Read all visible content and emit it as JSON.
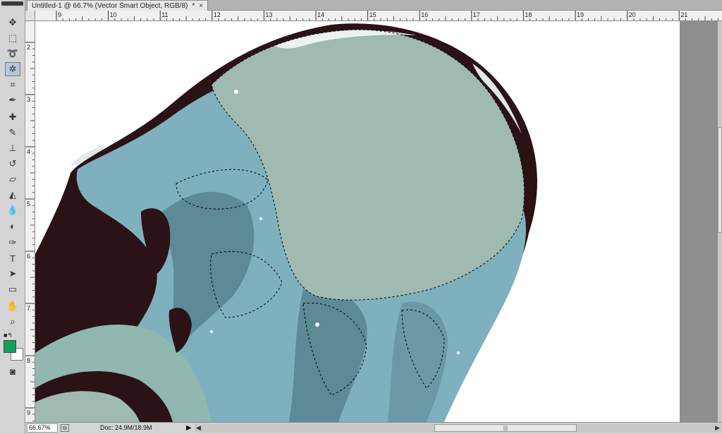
{
  "document": {
    "tab_title": "Untitled-1 @ 66.7% (Vector Smart Object, RGB/8)",
    "modified_marker": "*",
    "close_glyph": "×"
  },
  "rulers": {
    "horizontal": [
      "9",
      "10",
      "11",
      "12",
      "13",
      "14",
      "15",
      "16",
      "17",
      "18",
      "19",
      "20",
      "21"
    ],
    "vertical": [
      "2",
      "3",
      "4",
      "5",
      "6",
      "7",
      "8",
      "9"
    ]
  },
  "tools": [
    {
      "name": "move-icon",
      "glyph": "✥"
    },
    {
      "name": "marquee-icon",
      "glyph": "⬚"
    },
    {
      "name": "lasso-icon",
      "glyph": "➰"
    },
    {
      "name": "magic-wand-icon",
      "glyph": "✲"
    },
    {
      "name": "crop-icon",
      "glyph": "⌗"
    },
    {
      "name": "eyedropper-icon",
      "glyph": "✒"
    },
    {
      "name": "healing-brush-icon",
      "glyph": "✚"
    },
    {
      "name": "brush-icon",
      "glyph": "✎"
    },
    {
      "name": "clone-stamp-icon",
      "glyph": "⊥"
    },
    {
      "name": "history-brush-icon",
      "glyph": "↺"
    },
    {
      "name": "eraser-icon",
      "glyph": "▱"
    },
    {
      "name": "paint-bucket-icon",
      "glyph": "◭"
    },
    {
      "name": "blur-icon",
      "glyph": "💧"
    },
    {
      "name": "dodge-icon",
      "glyph": "◐"
    },
    {
      "name": "pen-icon",
      "glyph": "✑"
    },
    {
      "name": "type-icon",
      "glyph": "T"
    },
    {
      "name": "path-selection-icon",
      "glyph": "➤"
    },
    {
      "name": "shape-icon",
      "glyph": "▭"
    },
    {
      "name": "hand-icon",
      "glyph": "✋"
    },
    {
      "name": "zoom-icon",
      "glyph": "⌕"
    }
  ],
  "colors": {
    "foreground": "#11a060",
    "background": "#ffffff",
    "jelly_light": "#9fbab0",
    "jelly_teal": "#7fb0bd",
    "jelly_dark": "#2a1216"
  },
  "status": {
    "zoom": "66.67%",
    "doc_info": "Doc: 24.9M/18.9M",
    "menu_arrow": "▶"
  }
}
